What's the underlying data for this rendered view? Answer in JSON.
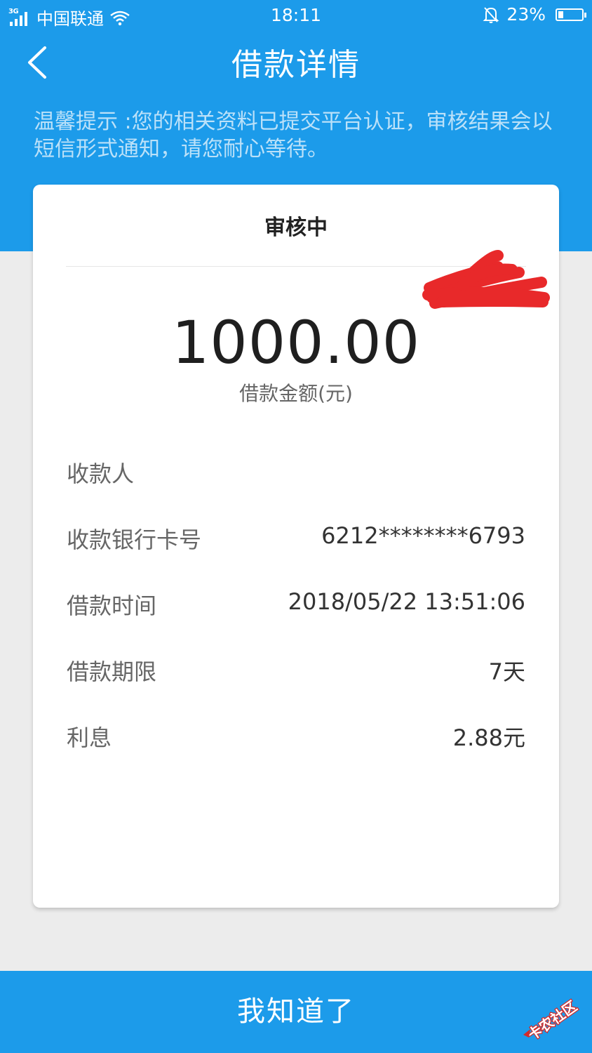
{
  "status_bar": {
    "network_type": "3G",
    "carrier": "中国联通",
    "time": "18:11",
    "battery": "23%",
    "battery_level": 0.23
  },
  "header": {
    "title": "借款详情",
    "back_icon": "chevron-left-icon"
  },
  "tip": "温馨提示 :您的相关资料已提交平台认证，审核结果会以短信形式通知，请您耐心等待。",
  "card": {
    "status": "审核中",
    "amount": "1000.00",
    "amount_label": "借款金额(元)",
    "rows": [
      {
        "label": "收款人",
        "value": ""
      },
      {
        "label": "收款银行卡号",
        "value": "6212********6793"
      },
      {
        "label": "借款时间",
        "value": "2018/05/22 13:51:06"
      },
      {
        "label": "借款期限",
        "value": "7天"
      },
      {
        "label": "利息",
        "value": "2.88元"
      }
    ]
  },
  "button": {
    "label": "我知道了"
  },
  "watermark": "卡农社区",
  "colors": {
    "primary": "#1c9bea",
    "background": "#ececec",
    "redaction": "#e8292a"
  }
}
